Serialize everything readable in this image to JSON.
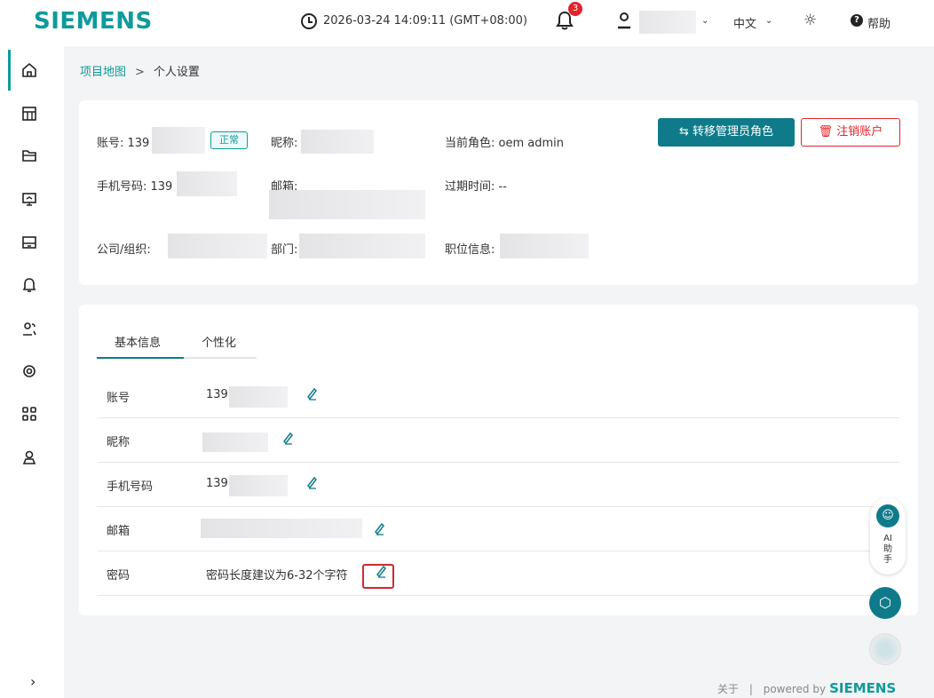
{
  "header": {
    "logo": "SIEMENS",
    "datetime": "2026-03-24 14:09:11  (GMT+08:00)",
    "notification_count": "3",
    "language": "中文",
    "help": "帮助",
    "help_icon_glyph": "?"
  },
  "breadcrumb": {
    "parent": "项目地图",
    "separator": ">",
    "current": "个人设置"
  },
  "account_card": {
    "account_label": "账号: 139",
    "status": "正常",
    "nickname_label": "昵称:",
    "role_label": "当前角色: oem admin",
    "phone_label": "手机号码: 139",
    "email_label": "邮箱:",
    "expire_label": "过期时间: --",
    "company_label": "公司/组织:",
    "department_label": "部门:",
    "position_label": "职位信息:",
    "transfer_button": "⇆ 转移管理员角色",
    "cancel_button": "🗑 注销账户"
  },
  "settings": {
    "tabs": [
      {
        "label": "基本信息",
        "active": true
      },
      {
        "label": "个性化",
        "active": false
      }
    ],
    "rows": [
      {
        "label": "账号",
        "value": "139"
      },
      {
        "label": "昵称",
        "value": ""
      },
      {
        "label": "手机号码",
        "value": "139"
      },
      {
        "label": "邮箱",
        "value": ""
      },
      {
        "label": "密码",
        "value": "密码长度建议为6-32个字符"
      }
    ]
  },
  "float": {
    "ai_label": "AI 助 手"
  },
  "footer": {
    "about": "关于",
    "separator": "|",
    "powered_by": "powered by",
    "brand": "SIEMENS"
  },
  "colors": {
    "brand": "#0f9a9b",
    "primary_button": "#0f7b8a",
    "danger": "#e0242b"
  },
  "icons": [
    "clock-icon",
    "bell-icon",
    "user-icon",
    "sun-icon",
    "help-icon",
    "home-icon",
    "dashboard-icon",
    "folder-icon",
    "monitor-icon",
    "device-icon",
    "bell-outline-icon",
    "users-icon",
    "settings-icon",
    "apps-icon",
    "user-badge-icon",
    "edit-icon",
    "robot-icon",
    "cube-icon"
  ]
}
